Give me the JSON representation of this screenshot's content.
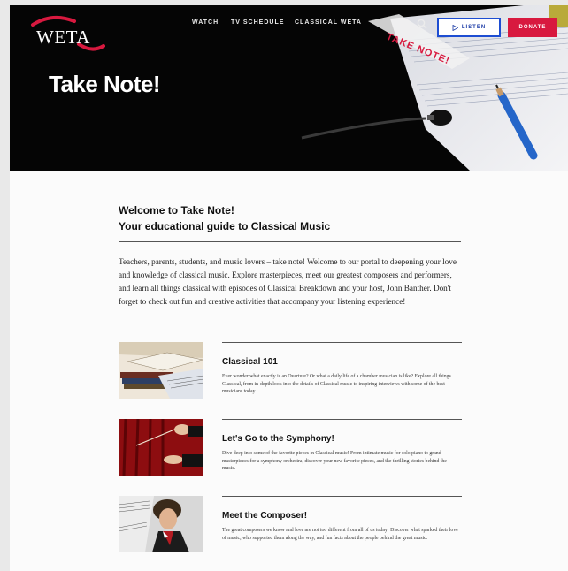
{
  "header": {
    "logo_text": "WETA",
    "nav": [
      "WATCH",
      "TV SCHEDULE",
      "CLASSICAL WETA"
    ],
    "listen_label": "LISTEN",
    "donate_label": "DONATE",
    "hero_title": "Take Note!",
    "stamp_text": "TAKE NOTE!"
  },
  "intro": {
    "title_line1": "Welcome to Take Note!",
    "title_line2": "Your educational guide to Classical Music",
    "body": "Teachers, parents, students, and music lovers – take note! Welcome to our portal to deepening your love and knowledge of classical music. Explore masterpieces, meet our greatest composers and performers, and learn all things classical with episodes of Classical Breakdown and your host, John Banther. Don't forget to check out fun and creative activities that accompany your listening experience!"
  },
  "items": [
    {
      "title": "Classical 101",
      "desc": "Ever wonder what exactly is an Overture? Or what a daily life of a chamber musician is like? Explore all things Classical, from in-depth look into the details of Classical music to inspiring interviews with some of the best musicians today."
    },
    {
      "title": "Let's Go to the Symphony!",
      "desc": "Dive deep into some of the favorite pieces in Classical music! From intimate music for solo piano to grand masterpieces for a symphony orchestra, discover your new favorite pieces, and the thrilling stories behind the music."
    },
    {
      "title": "Meet the Composer!",
      "desc": "The great composers we know and love are not too different from all of us today! Discover what sparked their love of music, who supported them along the way, and fun facts about the people behind the great music."
    }
  ],
  "colors": {
    "listen_border": "#1d4dd2",
    "donate": "#d8193f",
    "logo_swoosh": "#d8193f"
  },
  "icons": {
    "search": "search-icon",
    "play": "play-icon"
  }
}
